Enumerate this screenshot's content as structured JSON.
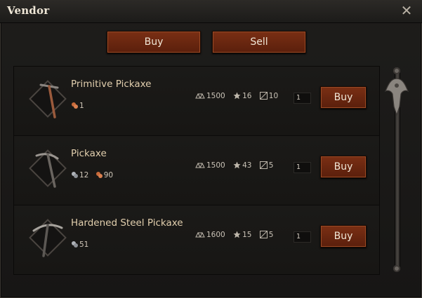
{
  "window": {
    "title": "Vendor",
    "close_icon": "close-icon"
  },
  "tabs": {
    "buy_label": "Buy",
    "sell_label": "Sell"
  },
  "items": [
    {
      "name": "Primitive Pickaxe",
      "icon": "primitive-pickaxe-icon",
      "reqs": [
        {
          "icon": "copper-ore-icon",
          "value": "1"
        }
      ],
      "stats": {
        "weight": "1500",
        "level": "16",
        "durability": "10"
      },
      "quantity": "1",
      "buy_label": "Buy"
    },
    {
      "name": "Pickaxe",
      "icon": "pickaxe-icon",
      "reqs": [
        {
          "icon": "iron-ore-icon",
          "value": "12"
        },
        {
          "icon": "copper-ore-icon",
          "value": "90"
        }
      ],
      "stats": {
        "weight": "1500",
        "level": "43",
        "durability": "5"
      },
      "quantity": "1",
      "buy_label": "Buy"
    },
    {
      "name": "Hardened Steel Pickaxe",
      "icon": "steel-pickaxe-icon",
      "reqs": [
        {
          "icon": "iron-ore-icon",
          "value": "51"
        }
      ],
      "stats": {
        "weight": "1600",
        "level": "15",
        "durability": "5"
      },
      "quantity": "1",
      "buy_label": "Buy"
    }
  ],
  "colors": {
    "button": "#6a2711",
    "item_name": "#e2cfae",
    "panel": "#1b1a18"
  }
}
